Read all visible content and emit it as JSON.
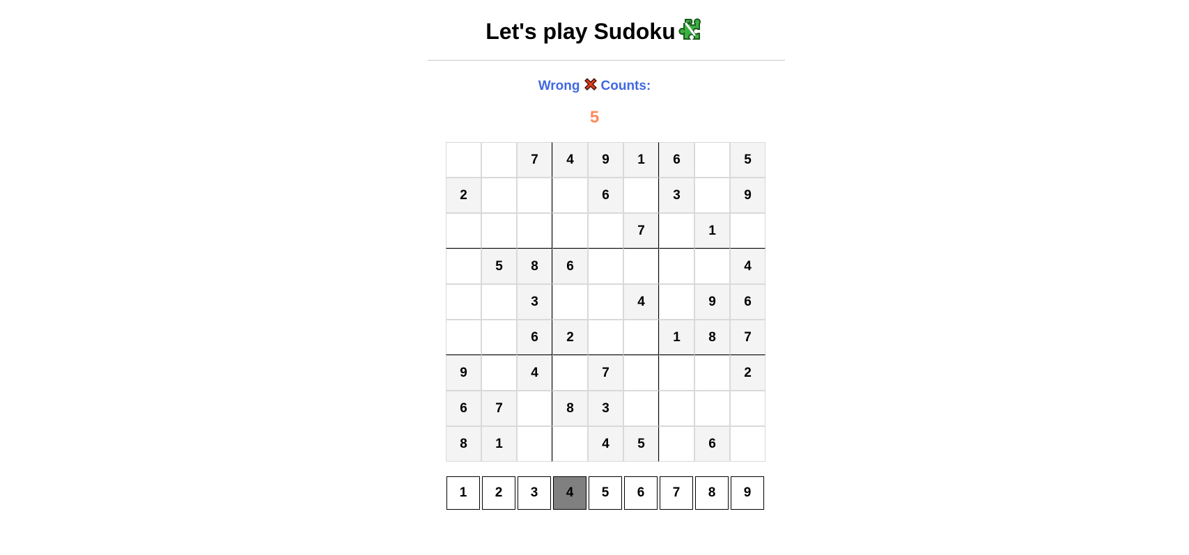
{
  "header": {
    "title": "Let's play Sudoku",
    "title_icon": "puzzle-piece-icon",
    "title_icon_color": "#3cb043"
  },
  "status": {
    "wrong_prefix": "Wrong",
    "wrong_icon": "cross-mark-icon",
    "wrong_icon_color": "#e03c1e",
    "wrong_suffix": "Counts:",
    "wrong_count": "5",
    "label_color": "#4169e1",
    "count_color": "#ff8a5c"
  },
  "board": {
    "rows": [
      [
        "",
        "",
        "7",
        "4",
        "9",
        "1",
        "6",
        "",
        "5"
      ],
      [
        "2",
        "",
        "",
        "",
        "6",
        "",
        "3",
        "",
        "9"
      ],
      [
        "",
        "",
        "",
        "",
        "",
        "7",
        "",
        "1",
        ""
      ],
      [
        "",
        "5",
        "8",
        "6",
        "",
        "",
        "",
        "",
        "4"
      ],
      [
        "",
        "",
        "3",
        "",
        "",
        "4",
        "",
        "9",
        "6"
      ],
      [
        "",
        "",
        "6",
        "2",
        "",
        "",
        "1",
        "8",
        "7"
      ],
      [
        "9",
        "",
        "4",
        "",
        "7",
        "",
        "",
        "",
        "2"
      ],
      [
        "6",
        "7",
        "",
        "8",
        "3",
        "",
        "",
        "",
        ""
      ],
      [
        "8",
        "1",
        "",
        "",
        "4",
        "5",
        "",
        "6",
        ""
      ]
    ],
    "given_color": "#f4f4f4"
  },
  "number_pad": {
    "digits": [
      "1",
      "2",
      "3",
      "4",
      "5",
      "6",
      "7",
      "8",
      "9"
    ],
    "selected": "4",
    "selected_color": "#808080"
  }
}
